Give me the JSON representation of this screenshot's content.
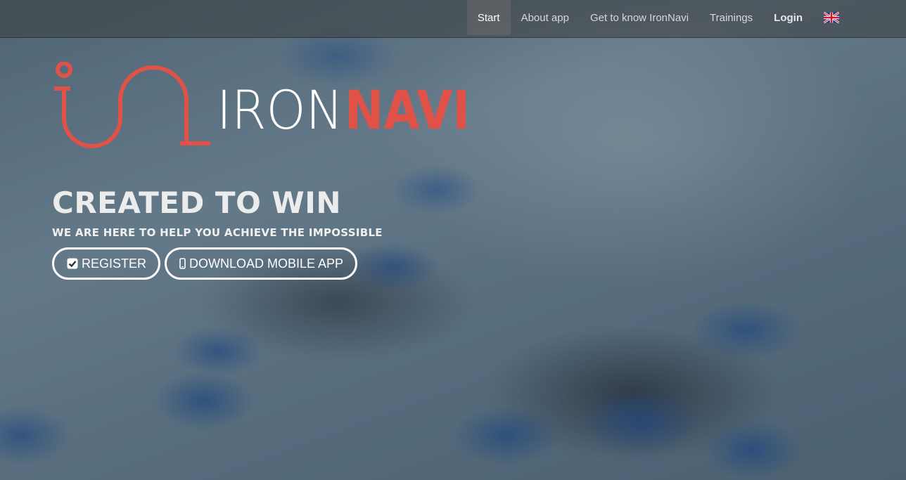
{
  "nav": {
    "items": [
      {
        "label": "Start"
      },
      {
        "label": "About app"
      },
      {
        "label": "Get to know IronNavi"
      },
      {
        "label": "Trainings"
      },
      {
        "label": "Login"
      }
    ],
    "language_icon": "uk-flag-icon"
  },
  "hero": {
    "logo_text_light": "IRON",
    "logo_text_bold": "NAVI",
    "headline": "CREATED TO WIN",
    "subline": "WE ARE HERE TO HELP YOU ACHIEVE THE IMPOSSIBLE",
    "register_label": "REGISTER",
    "download_label": "DOWNLOAD MOBILE APP",
    "register_icon": "checkbox-icon",
    "download_icon": "mobile-phone-icon"
  },
  "colors": {
    "brand_red": "#e05248",
    "navbar_bg": "#3c3c3c",
    "text_light": "#ececec"
  }
}
